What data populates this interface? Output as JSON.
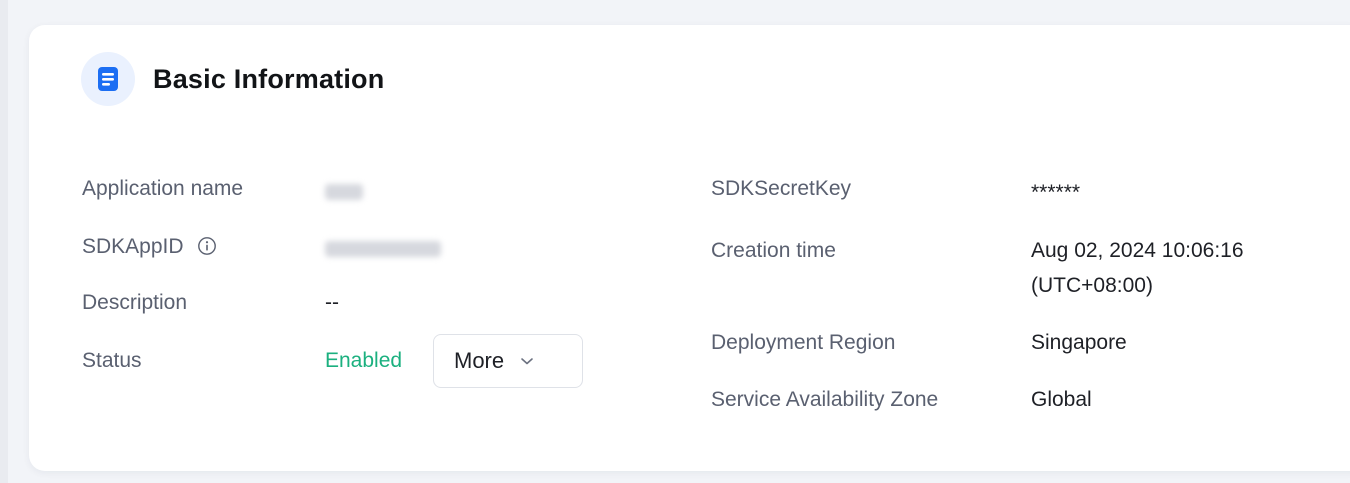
{
  "section": {
    "title": "Basic Information",
    "icon": "document-icon"
  },
  "left_fields": {
    "app_name_label": "Application name",
    "sdkappid_label": "SDKAppID",
    "description_label": "Description",
    "description_value": "--",
    "status_label": "Status",
    "status_value": "Enabled",
    "more_button_label": "More"
  },
  "right_fields": {
    "secret_key_label": "SDKSecretKey",
    "secret_key_value": "******",
    "creation_time_label": "Creation time",
    "creation_time_value_line1": "Aug 02, 2024 10:06:16",
    "creation_time_value_line2": "(UTC+08:00)",
    "region_label": "Deployment Region",
    "region_value": "Singapore",
    "zone_label": "Service Availability Zone",
    "zone_value": "Global"
  },
  "colors": {
    "accent": "#1c6ef3",
    "icon_bg": "#eaf1fe",
    "enabled": "#1bb07f"
  }
}
